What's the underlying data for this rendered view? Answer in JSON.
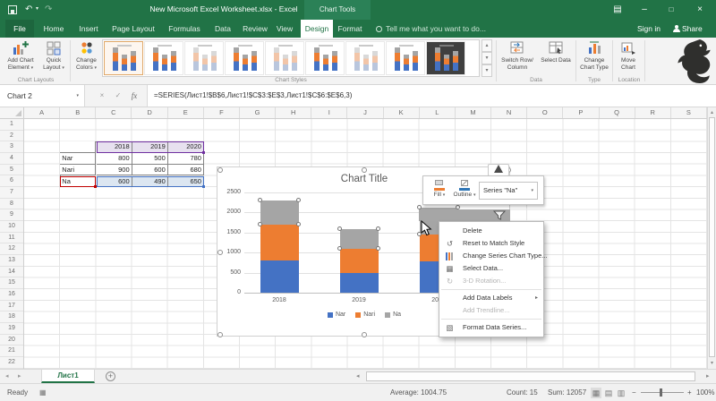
{
  "window": {
    "title": "New Microsoft Excel Worksheet.xlsx - Excel",
    "context_tab_label": "Chart Tools",
    "sign_in_label": "Sign in",
    "share_label": "Share",
    "tell_me_label": "Tell me what you want to do..."
  },
  "icons": {
    "dropdown": "▾",
    "submenu": "▸",
    "up": "▴",
    "down": "▾",
    "left": "◂",
    "right": "▸",
    "undo": "↶",
    "redo": "↷",
    "minimize": "–",
    "maximize": "□",
    "close": "×",
    "ribbon_display": "▤",
    "collapse": "∧",
    "cancel": "×",
    "enter": "✓",
    "plus": "+",
    "macro": "▦",
    "view_normal": "▦",
    "view_layout": "▤",
    "view_break": "▥",
    "zoom_minus": "−",
    "zoom_plus": "+",
    "reset": "↺",
    "rotate": "↻",
    "select_data": "▦",
    "format": "▧"
  },
  "menu_tabs": [
    {
      "label": "File",
      "active": false,
      "file": true
    },
    {
      "label": "Home",
      "active": false,
      "file": false
    },
    {
      "label": "Insert",
      "active": false,
      "file": false
    },
    {
      "label": "Page Layout",
      "active": false,
      "file": false
    },
    {
      "label": "Formulas",
      "active": false,
      "file": false
    },
    {
      "label": "Data",
      "active": false,
      "file": false
    },
    {
      "label": "Review",
      "active": false,
      "file": false
    },
    {
      "label": "View",
      "active": false,
      "file": false
    },
    {
      "label": "Design",
      "active": true,
      "file": false
    },
    {
      "label": "Format",
      "active": false,
      "file": false
    }
  ],
  "ribbon": {
    "add_chart_element": "Add Chart Element",
    "quick_layout": "Quick Layout",
    "change_colors": "Change Colors",
    "switch_row_column": "Switch Row/ Column",
    "select_data": "Select Data",
    "change_chart_type": "Change Chart Type",
    "move_chart": "Move Chart",
    "group_labels": [
      "Chart Layouts",
      "Chart Styles",
      "Data",
      "Type",
      "Location"
    ],
    "style_gallery": [
      "selected",
      "plain",
      "mono",
      "plain",
      "mono",
      "plain",
      "mono",
      "plain",
      "dark"
    ]
  },
  "formula_bar": {
    "name_box": "Chart 2",
    "fx": "fx",
    "formula": "=SERIES(Лист1!$B$6,Лист1!$C$3:$E$3,Лист1!$C$6:$E$6,3)"
  },
  "grid": {
    "columns": [
      "A",
      "B",
      "C",
      "D",
      "E",
      "F",
      "G",
      "H",
      "I",
      "J",
      "K",
      "L",
      "M",
      "N",
      "O",
      "P",
      "Q",
      "R",
      "S"
    ],
    "rows": [
      "1",
      "2",
      "3",
      "4",
      "5",
      "6",
      "7",
      "8",
      "9",
      "10",
      "11",
      "12",
      "13",
      "14",
      "15",
      "16",
      "17",
      "18",
      "19",
      "20",
      "21",
      "22"
    ]
  },
  "table": {
    "header_row": {
      "years": [
        "2018",
        "2019",
        "2020"
      ]
    },
    "data_rows": [
      {
        "label": "Nar",
        "values": [
          "800",
          "500",
          "780"
        ]
      },
      {
        "label": "Nari",
        "values": [
          "900",
          "600",
          "680"
        ]
      },
      {
        "label": "Na",
        "values": [
          "600",
          "490",
          "650"
        ]
      }
    ]
  },
  "chart_data": {
    "type": "bar",
    "stacked": true,
    "title": "Chart Title",
    "categories": [
      "2018",
      "2019",
      "2020"
    ],
    "series": [
      {
        "name": "Nar",
        "color": "#4472c4",
        "values": [
          800,
          500,
          780
        ]
      },
      {
        "name": "Nari",
        "color": "#ed7d31",
        "values": [
          900,
          600,
          680
        ]
      },
      {
        "name": "Na",
        "color": "#a5a5a5",
        "values": [
          600,
          490,
          650
        ]
      }
    ],
    "ylim": [
      0,
      2500
    ],
    "yticks": [
      0,
      500,
      1000,
      1500,
      2000,
      2500
    ],
    "xlabel": "",
    "ylabel": "",
    "grid": true,
    "legend_position": "bottom"
  },
  "selection": {
    "series": "Na"
  },
  "mini_toolbar": {
    "fill_label": "Fill",
    "outline_label": "Outline",
    "series_selector": "Series \"Na\""
  },
  "context_menu": {
    "items": [
      {
        "label": "Delete",
        "icon": "none",
        "enabled": true,
        "submenu": false
      },
      {
        "label": "Reset to Match Style",
        "icon": "reset",
        "enabled": true,
        "submenu": false
      },
      {
        "label": "Change Series Chart Type...",
        "icon": "bars",
        "enabled": true,
        "submenu": false
      },
      {
        "label": "Select Data...",
        "icon": "select_data",
        "enabled": true,
        "submenu": false
      },
      {
        "label": "3-D Rotation...",
        "icon": "rotate",
        "enabled": false,
        "submenu": false
      },
      {
        "separator": true
      },
      {
        "label": "Add Data Labels",
        "icon": "none",
        "enabled": true,
        "submenu": true
      },
      {
        "label": "Add Trendline...",
        "icon": "none",
        "enabled": false,
        "submenu": false
      },
      {
        "separator": true
      },
      {
        "label": "Format Data Series...",
        "icon": "format",
        "enabled": true,
        "submenu": false
      }
    ]
  },
  "sheet_tabs": {
    "active": "Лист1"
  },
  "status_bar": {
    "ready": "Ready",
    "average": "Average: 1004.75",
    "count": "Count: 15",
    "sum": "Sum: 12057",
    "zoom_level": "100%"
  }
}
